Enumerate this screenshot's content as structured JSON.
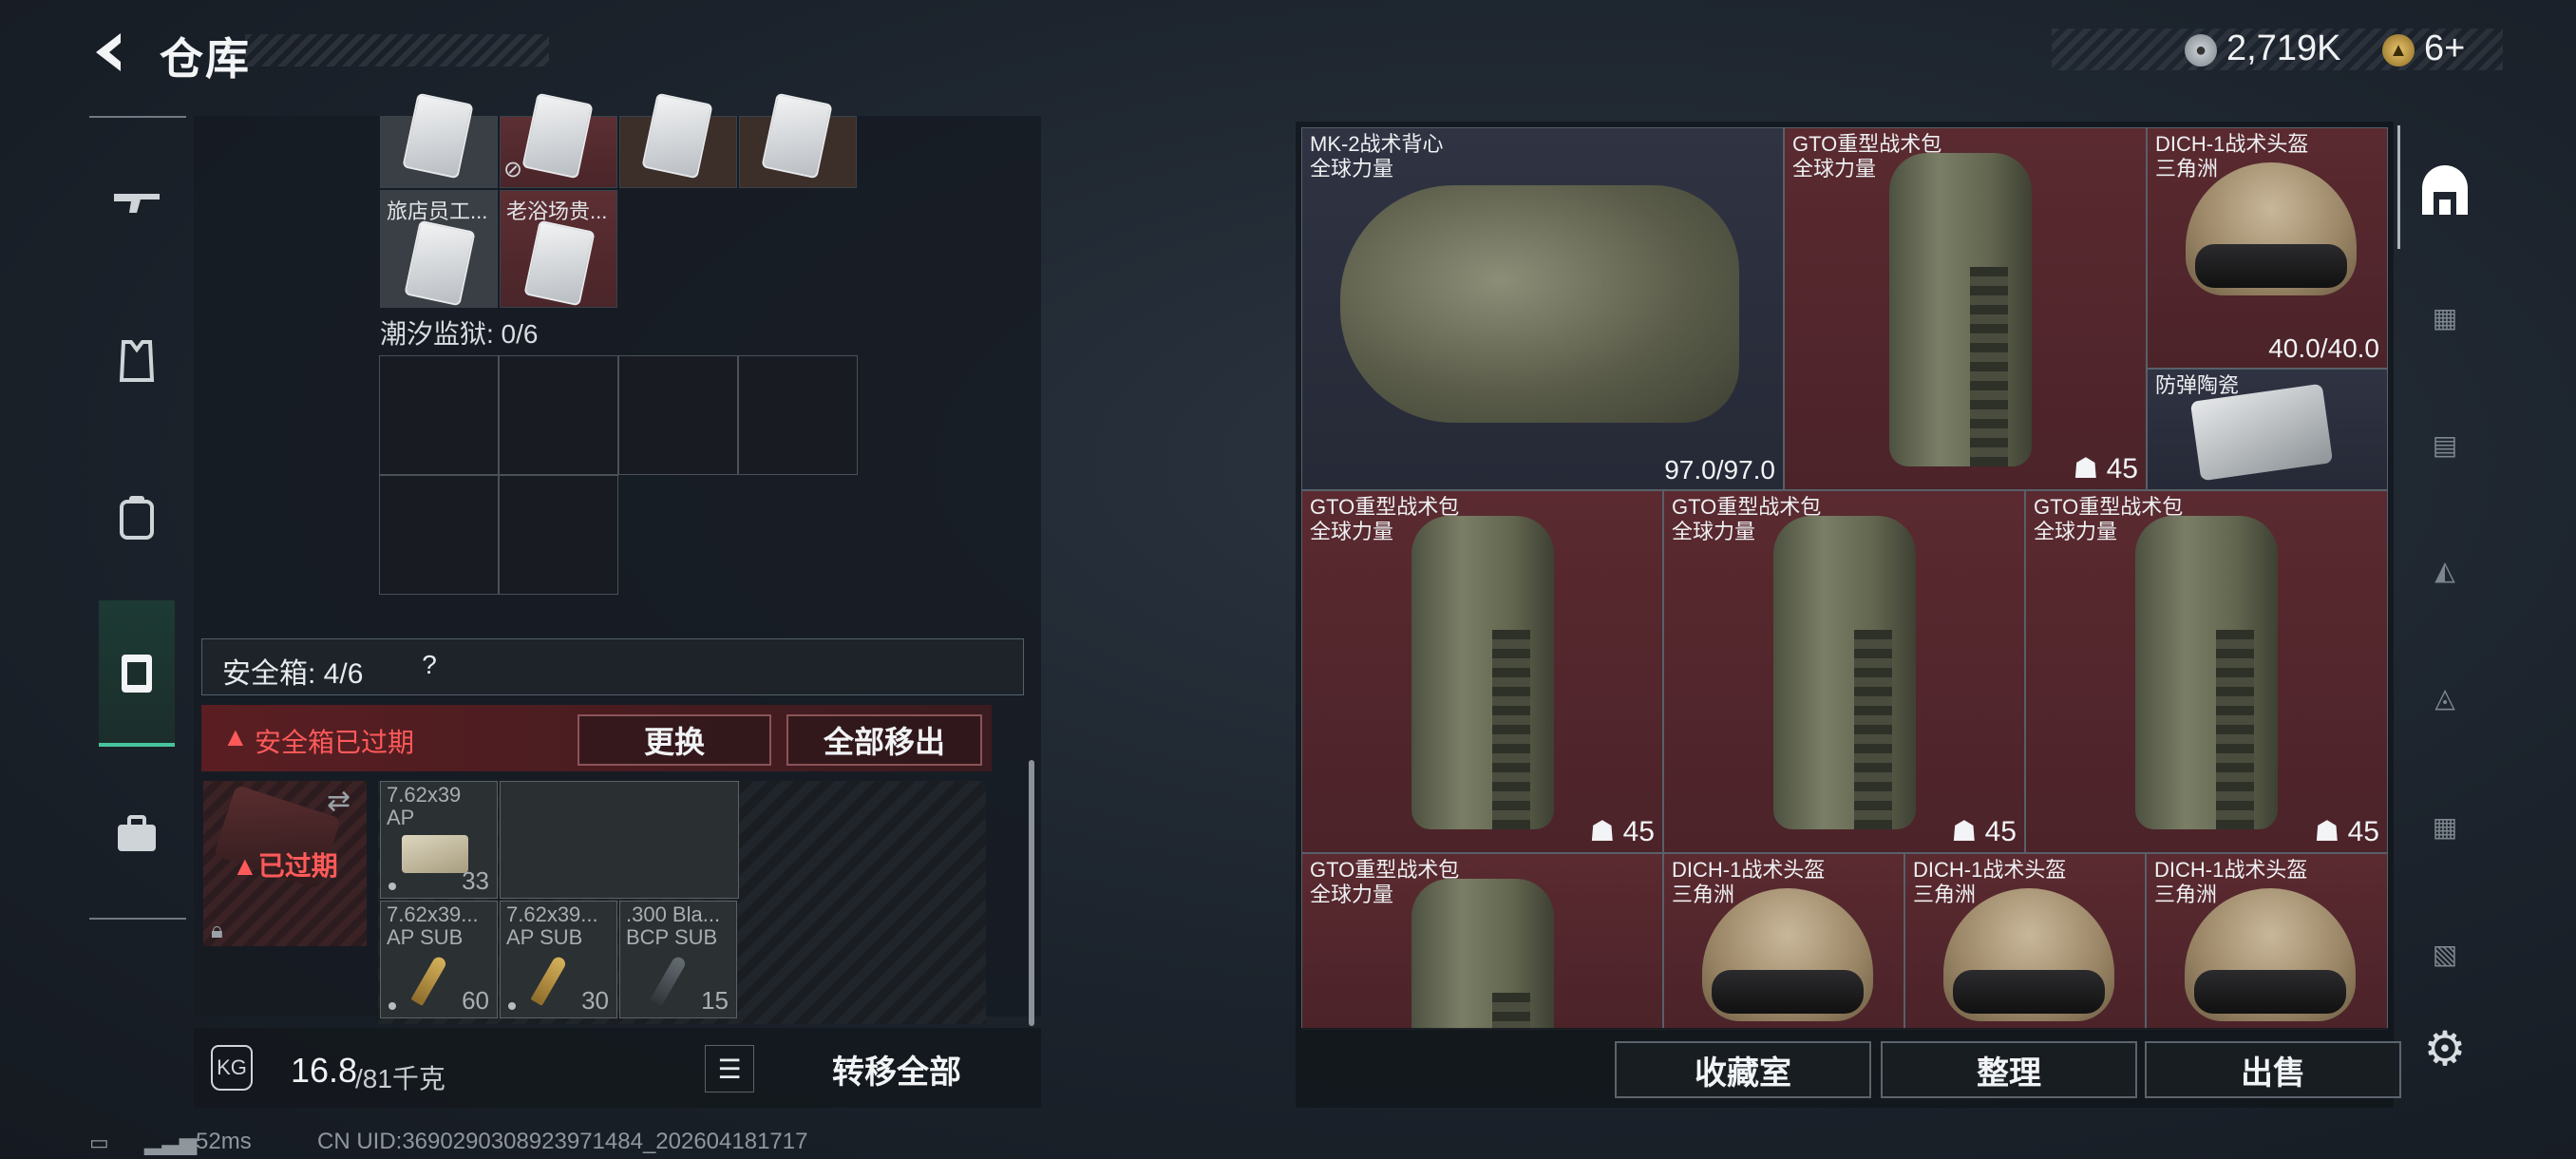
{
  "header": {
    "title": "仓库",
    "currency_silver": "2,719K",
    "currency_gold": "6+"
  },
  "nav": {
    "items": [
      {
        "icon": "rifle-icon"
      },
      {
        "icon": "vest-icon"
      },
      {
        "icon": "backpack-icon"
      },
      {
        "icon": "safe-box-icon"
      },
      {
        "icon": "toolbox-icon"
      }
    ]
  },
  "left": {
    "items_row2": [
      "旅店员工...",
      "老浴场贵..."
    ],
    "prison_label": "潮汐监狱: 0/6",
    "safe_box_label": "安全箱: 4/6",
    "help": "?",
    "expired_warning": "安全箱已过期",
    "replace_button": "更换",
    "move_all_button": "全部移出",
    "expired_tag": "已过期",
    "ammo": [
      {
        "name": "7.62x39",
        "sub": "AP",
        "count": "33"
      },
      {
        "name": "7.62x39...",
        "sub": "AP SUB",
        "count": "60"
      },
      {
        "name": "7.62x39...",
        "sub": "AP SUB",
        "count": "30"
      },
      {
        "name": ".300 Bla...",
        "sub": "BCP SUB",
        "count": "15"
      }
    ],
    "weight_current": "16.8",
    "weight_max": "/81千克",
    "transfer_all": "转移全部"
  },
  "status": {
    "ping": "52ms",
    "uid": "CN UID:3690290308923971484_202604181717"
  },
  "grid": {
    "vest": {
      "name": "MK-2战术背心",
      "sub": "全球力量",
      "value": "97.0/97.0"
    },
    "pack_top": {
      "name": "GTO重型战术包",
      "sub": "全球力量",
      "count": "45"
    },
    "helmet_top": {
      "name": "DICH-1战术头盔",
      "sub": "三角洲",
      "value": "40.0/40.0"
    },
    "plate": {
      "name": "防弹陶瓷"
    },
    "packs_mid": [
      {
        "name": "GTO重型战术包",
        "sub": "全球力量",
        "count": "45"
      },
      {
        "name": "GTO重型战术包",
        "sub": "全球力量",
        "count": "45"
      },
      {
        "name": "GTO重型战术包",
        "sub": "全球力量",
        "count": "45"
      }
    ],
    "pack_bottom": {
      "name": "GTO重型战术包",
      "sub": "全球力量"
    },
    "helmets_bottom": [
      {
        "name": "DICH-1战术头盔",
        "sub": "三角洲"
      },
      {
        "name": "DICH-1战术头盔",
        "sub": "三角洲"
      },
      {
        "name": "DICH-1战术头盔",
        "sub": "三角洲"
      }
    ]
  },
  "right_buttons": {
    "collection": "收藏室",
    "organize": "整理",
    "sell": "出售"
  },
  "colors": {
    "accent_green": "#48c49d",
    "warning_red": "#ff5a5a",
    "item_red_bg": "#5a2a30"
  }
}
